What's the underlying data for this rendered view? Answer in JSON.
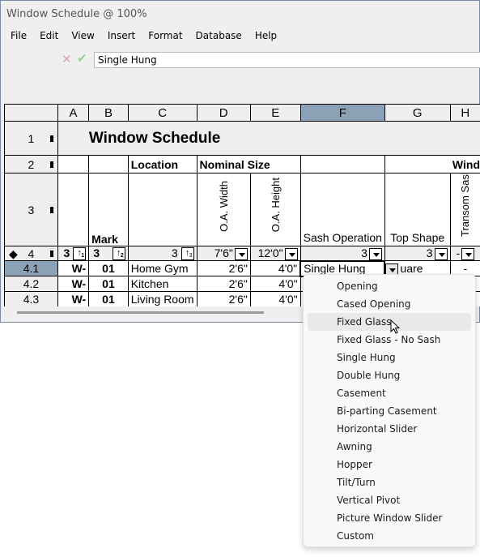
{
  "window": {
    "title": "Window Schedule @ 100%"
  },
  "menubar": [
    "File",
    "Edit",
    "View",
    "Insert",
    "Format",
    "Database",
    "Help"
  ],
  "editbar": {
    "value": "Single Hung"
  },
  "columns": [
    "A",
    "B",
    "C",
    "D",
    "E",
    "F",
    "G",
    "H"
  ],
  "selected_column": "F",
  "rows": {
    "r1": {
      "num": "1",
      "title": "Window Schedule"
    },
    "r2": {
      "num": "2",
      "location": "Location",
      "nominal": "Nominal Size",
      "wind": "Wind"
    },
    "r3": {
      "num": "3",
      "mark": "Mark",
      "oa_width": "O.A. Width",
      "oa_height": "O.A. Height",
      "sash": "Sash Operation",
      "top": "Top Shape",
      "transom": "Transom Sash"
    },
    "r4": {
      "num": "4",
      "a": "3",
      "a_sort": "1",
      "b": "3",
      "b_sort": "2",
      "c": "3",
      "c_sort": "3",
      "d": "7'6\"",
      "e": "12'0\"",
      "f": "3",
      "g": "3",
      "h": "-"
    },
    "data": [
      {
        "num": "4.1",
        "a": "W-",
        "b": "01",
        "c": "Home Gym",
        "d": "2'6\"",
        "e": "4'0\"",
        "f": "Single Hung",
        "g": "uare",
        "h": "-"
      },
      {
        "num": "4.2",
        "a": "W-",
        "b": "01",
        "c": "Kitchen",
        "d": "2'6\"",
        "e": "4'0\""
      },
      {
        "num": "4.3",
        "a": "W-",
        "b": "01",
        "c": "Living Room",
        "d": "2'6\"",
        "e": "4'0\""
      }
    ]
  },
  "dropdown": {
    "items": [
      "Opening",
      "Cased Opening",
      "Fixed Glass",
      "Fixed Glass - No Sash",
      "Single Hung",
      "Double Hung",
      "Casement",
      "Bi-parting Casement",
      "Horizontal Slider",
      "Awning",
      "Hopper",
      "Tilt/Turn",
      "Vertical Pivot",
      "Picture Window Slider",
      "Custom"
    ],
    "highlighted": "Fixed Glass"
  },
  "colors": {
    "selected_header": "#8ba1b5",
    "background": "#efefef"
  }
}
